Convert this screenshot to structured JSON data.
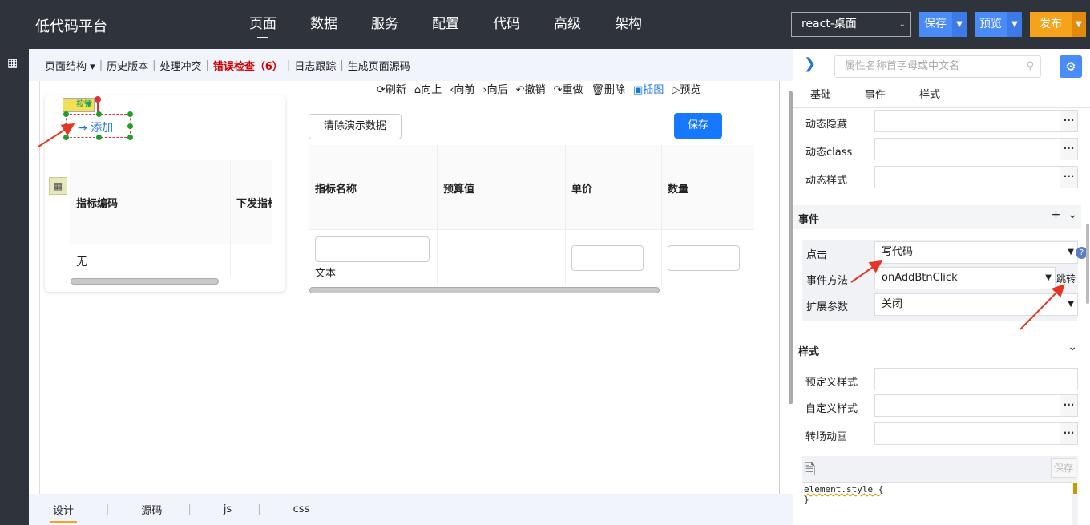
{
  "brand": "低代码平台",
  "nav": [
    "页面",
    "数据",
    "服务",
    "配置",
    "代码",
    "高级",
    "架构"
  ],
  "env": {
    "value": "react-桌面"
  },
  "top_buttons": {
    "save": "保存",
    "preview": "预览",
    "publish": "发布"
  },
  "subbar": {
    "structure": "页面结构",
    "history": "历史版本",
    "conflict": "处理冲突",
    "error_check": "错误检查（6）",
    "log": "日志跟踪",
    "gen_source": "生成页面源码"
  },
  "toolbar": [
    "刷新",
    "向上",
    "向前",
    "向后",
    "撤销",
    "重做",
    "删除",
    "插图",
    "预览"
  ],
  "canvas": {
    "button_tag": "按钮",
    "add_button": "添加",
    "table1": {
      "headers": [
        "指标编码",
        "下发指标"
      ],
      "row": [
        "无"
      ]
    },
    "clear_demo": "清除演示数据",
    "save": "保存",
    "table2": {
      "headers": [
        "指标名称",
        "预算值",
        "单价",
        "数量"
      ],
      "cell_text": "文本"
    }
  },
  "bottom_tabs": [
    "设计",
    "源码",
    "js",
    "css"
  ],
  "props": {
    "search_placeholder": "属性名称首字母或中文名",
    "tabs": [
      "基础",
      "事件",
      "样式"
    ],
    "rows_top": [
      "动态隐藏",
      "动态class",
      "动态样式"
    ],
    "events_title": "事件",
    "events_add": "+",
    "click_label": "点击",
    "click_value": "写代码",
    "method_label": "事件方法",
    "method_value": "onAddBtnClick",
    "jump": "跳转",
    "ext_label": "扩展参数",
    "ext_value": "关闭",
    "style_title": "样式",
    "style_rows": [
      "预定义样式",
      "自定义样式",
      "转场动画"
    ],
    "code_save": "保存",
    "code_line1": "element.style {",
    "code_line2": "}"
  }
}
